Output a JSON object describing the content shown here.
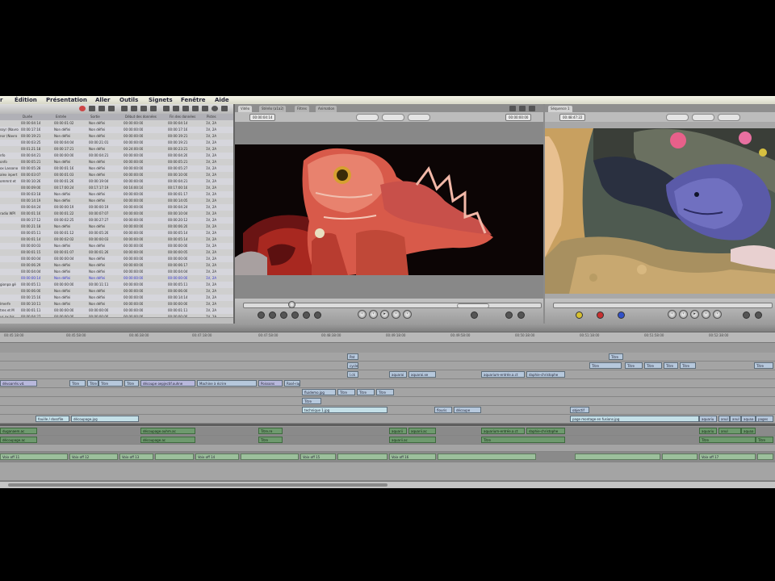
{
  "menu": [
    "r",
    "Édition",
    "Présentation",
    "Aller",
    "Outils",
    "Signets",
    "Fenêtre",
    "Aide"
  ],
  "browser": {
    "columns": [
      "Durée",
      "Entrée",
      "Sortie",
      "Début des données",
      "Fin des données",
      "Pistes"
    ],
    "name_fragments": [
      "",
      "ssyr (Navro",
      "nor (Navro",
      "",
      "",
      "nfo",
      "onfo",
      "ox Lassono",
      "alex inpert",
      "ommnt et",
      "",
      "",
      "",
      "",
      "radio WPI",
      "",
      "",
      "",
      "",
      "",
      "",
      "",
      "",
      "",
      "",
      "gionpa gé",
      "",
      "",
      "lmerfe",
      "tres et M",
      "us ax bis"
    ],
    "rows": [
      [
        "00:00:04:14",
        "00:00:01:02",
        "Non défini",
        "00:00:00:00",
        "00:00:04:14",
        "1V, 2A"
      ],
      [
        "00:00:17:16",
        "Non défini",
        "Non défini",
        "00:00:00:00",
        "00:00:17:16",
        "1V, 2A"
      ],
      [
        "00:00:19:21",
        "Non défini",
        "Non défini",
        "00:00:00:00",
        "00:00:19:21",
        "1V, 2A"
      ],
      [
        "00:00:03:25",
        "00:00:04:04",
        "00:00:21:01",
        "00:00:00:00",
        "00:00:19:21",
        "1V, 2A"
      ],
      [
        "00:01:21:18",
        "00:00:17:21",
        "Non défini",
        "00:24:00:00",
        "00:00:23:21",
        "1V, 2A"
      ],
      [
        "00:00:04:21",
        "00:00:00:00",
        "00:00:04:21",
        "00:00:00:00",
        "00:00:04:20",
        "1V, 2A"
      ],
      [
        "00:00:05:21",
        "Non défini",
        "Non défini",
        "00:00:00:00",
        "00:00:05:21",
        "1V, 2A"
      ],
      [
        "00:00:05:28",
        "00:00:01:16",
        "Non défini",
        "00:00:00:00",
        "00:00:05:27",
        "1V, 2A"
      ],
      [
        "00:00:03:07",
        "00:00:01:03",
        "Non défini",
        "00:00:00:00",
        "00:00:10:00",
        "1V, 2A"
      ],
      [
        "00:00:10:26",
        "00:00:01:26",
        "00:00:19:04",
        "00:00:00:00",
        "00:00:04:21",
        "1V, 2A"
      ],
      [
        "00:00:09:00",
        "00:17:00:24",
        "00:17:17:19",
        "00:16:00:16",
        "00:17:00:16",
        "1V, 2A"
      ],
      [
        "00:00:03:18",
        "Non défini",
        "Non défini",
        "00:00:00:00",
        "00:00:01:17",
        "1V, 2A"
      ],
      [
        "00:00:14:19",
        "Non défini",
        "Non défini",
        "00:00:00:00",
        "00:00:14:05",
        "1V, 2A"
      ],
      [
        "00:00:04:24",
        "00:00:00:19",
        "00:00:00:19",
        "00:00:00:00",
        "00:00:04:24",
        "1V, 2A"
      ],
      [
        "00:00:01:16",
        "00:00:01:22",
        "00:00:07:07",
        "00:00:00:00",
        "00:00:10:04",
        "1V, 2A"
      ],
      [
        "00:00:17:12",
        "00:00:02:25",
        "00:00:27:27",
        "00:00:00:00",
        "00:00:20:12",
        "1V, 2A"
      ],
      [
        "00:00:21:18",
        "Non défini",
        "Non défini",
        "00:00:00:00",
        "00:00:06:20",
        "1V, 2A"
      ],
      [
        "00:00:05:11",
        "00:00:01:12",
        "00:00:05:26",
        "00:00:00:00",
        "00:00:05:14",
        "1V, 2A"
      ],
      [
        "00:00:01:14",
        "00:00:02:02",
        "00:00:00:03",
        "00:00:00:00",
        "00:00:05:14",
        "1V, 2A"
      ],
      [
        "00:00:00:03",
        "Non défini",
        "Non défini",
        "00:00:00:00",
        "00:00:00:00",
        "1V, 2A"
      ],
      [
        "00:00:01:15",
        "00:00:01:07",
        "00:00:01:26",
        "00:00:00:00",
        "00:00:00:05",
        "1V, 2A"
      ],
      [
        "00:00:00:04",
        "00:00:00:04",
        "Non défini",
        "00:00:00:00",
        "00:00:00:00",
        "1V, 2A"
      ],
      [
        "00:00:06:29",
        "Non défini",
        "Non défini",
        "00:00:00:00",
        "00:00:06:17",
        "1V, 2A"
      ],
      [
        "00:00:04:04",
        "Non défini",
        "Non défini",
        "00:00:00:00",
        "00:00:04:04",
        "1V, 2A"
      ],
      [
        "00:00:00:14",
        "Non défini",
        "Non défini",
        "00:00:00:00",
        "00:00:00:00",
        "1V, 2A"
      ],
      [
        "00:00:05:11",
        "00:00:00:00",
        "00:00:11:11",
        "00:00:00:00",
        "00:00:05:11",
        "1V, 2A"
      ],
      [
        "00:00:06:00",
        "Non défini",
        "Non défini",
        "00:00:00:00",
        "00:00:06:00",
        "1V, 2A"
      ],
      [
        "00:00:15:16",
        "Non défini",
        "Non défini",
        "00:00:00:00",
        "00:00:14:14",
        "1V, 2A"
      ],
      [
        "00:00:10:11",
        "Non défini",
        "Non défini",
        "00:00:00:00",
        "00:00:00:00",
        "1V, 2A"
      ],
      [
        "00:00:01:11",
        "00:00:00:00",
        "00:00:00:00",
        "00:00:00:00",
        "00:00:01:11",
        "1V, 2A"
      ],
      [
        "00:00:04:27",
        "00:00:00:00",
        "00:00:00:00",
        "00:00:00:00",
        "00:00:00:00",
        "1V, 2A"
      ]
    ],
    "selected_row": 24
  },
  "viewer": {
    "tabs": [
      "Vidéo",
      "Stéréo (a1a2)",
      "Filtres",
      "Animation"
    ],
    "timecode_left": "00:00:04:14",
    "timecode_right": "00:00:00:00"
  },
  "canvas": {
    "tab": "Séquence 1",
    "timecode_left": "00:48:47:22",
    "timecode_right": "00:00:00:00"
  },
  "timeline": {
    "ruler": [
      "00:45:18:00",
      "00:45:58:00",
      "00:46:38:00",
      "00:47:18:00",
      "00:47:58:00",
      "00:48:38:00",
      "00:49:18:00",
      "00:49:58:00",
      "00:50:38:00",
      "00:51:18:00",
      "00:51:58:00",
      "00:52:38:00"
    ],
    "clips": {
      "track1": [
        "Pat",
        "Titre"
      ],
      "track2": [
        "cycle",
        "aymnt...",
        "Titre",
        "Titre",
        "Titre",
        "Titre",
        "Titre",
        "Titre",
        "Titre"
      ],
      "track3": [
        "l.ck",
        "aquarai",
        "aquarai.xe",
        "aquarium-entrée.a.ct",
        "daphie-christophe",
        "Titre",
        "Titre",
        "Titre",
        "Titre"
      ],
      "track4": [
        "dévoarrés.vd.",
        "Titre",
        "Titre",
        "Titre",
        "Titre",
        "découpe oepjectif.ouhne",
        "Machine à écrire",
        "Titre",
        "Poissons",
        "Rosé-rap",
        "fluidemo.jpg",
        "Titre",
        "Titre",
        "Titre"
      ],
      "track5": [
        "Titre",
        "technique 1.jpg"
      ],
      "track6": [
        "flouris",
        "découpe",
        "objectif",
        "page montage en fusions.jpg",
        "aquariu",
        "anul",
        "anul",
        "pages"
      ],
      "track7": [
        "fouille / dossfile",
        "découpage.jpg",
        "page montage en fusions.jpg",
        "aquariu",
        "anul",
        "anul",
        "aquaa"
      ],
      "track8": [
        "duganaem.ac",
        "découpage.ouhm.ac",
        "Titre.re",
        "aquarii",
        "aquarii.ac",
        "aquarium-entrée.a.ct",
        "daphie-christophe",
        "aquariu",
        "anul",
        "aquaa"
      ],
      "track9": [
        "découpage.ac",
        "Titre",
        "Titre",
        "Titre",
        "Titre",
        "aquarii.ac",
        "Titre"
      ],
      "track10": [
        "Voix off 11",
        "Voix off 12",
        "Voix off 13",
        "Voix off 14",
        "Voix off 15",
        "Voix off 16",
        "Voix off 17"
      ]
    }
  }
}
